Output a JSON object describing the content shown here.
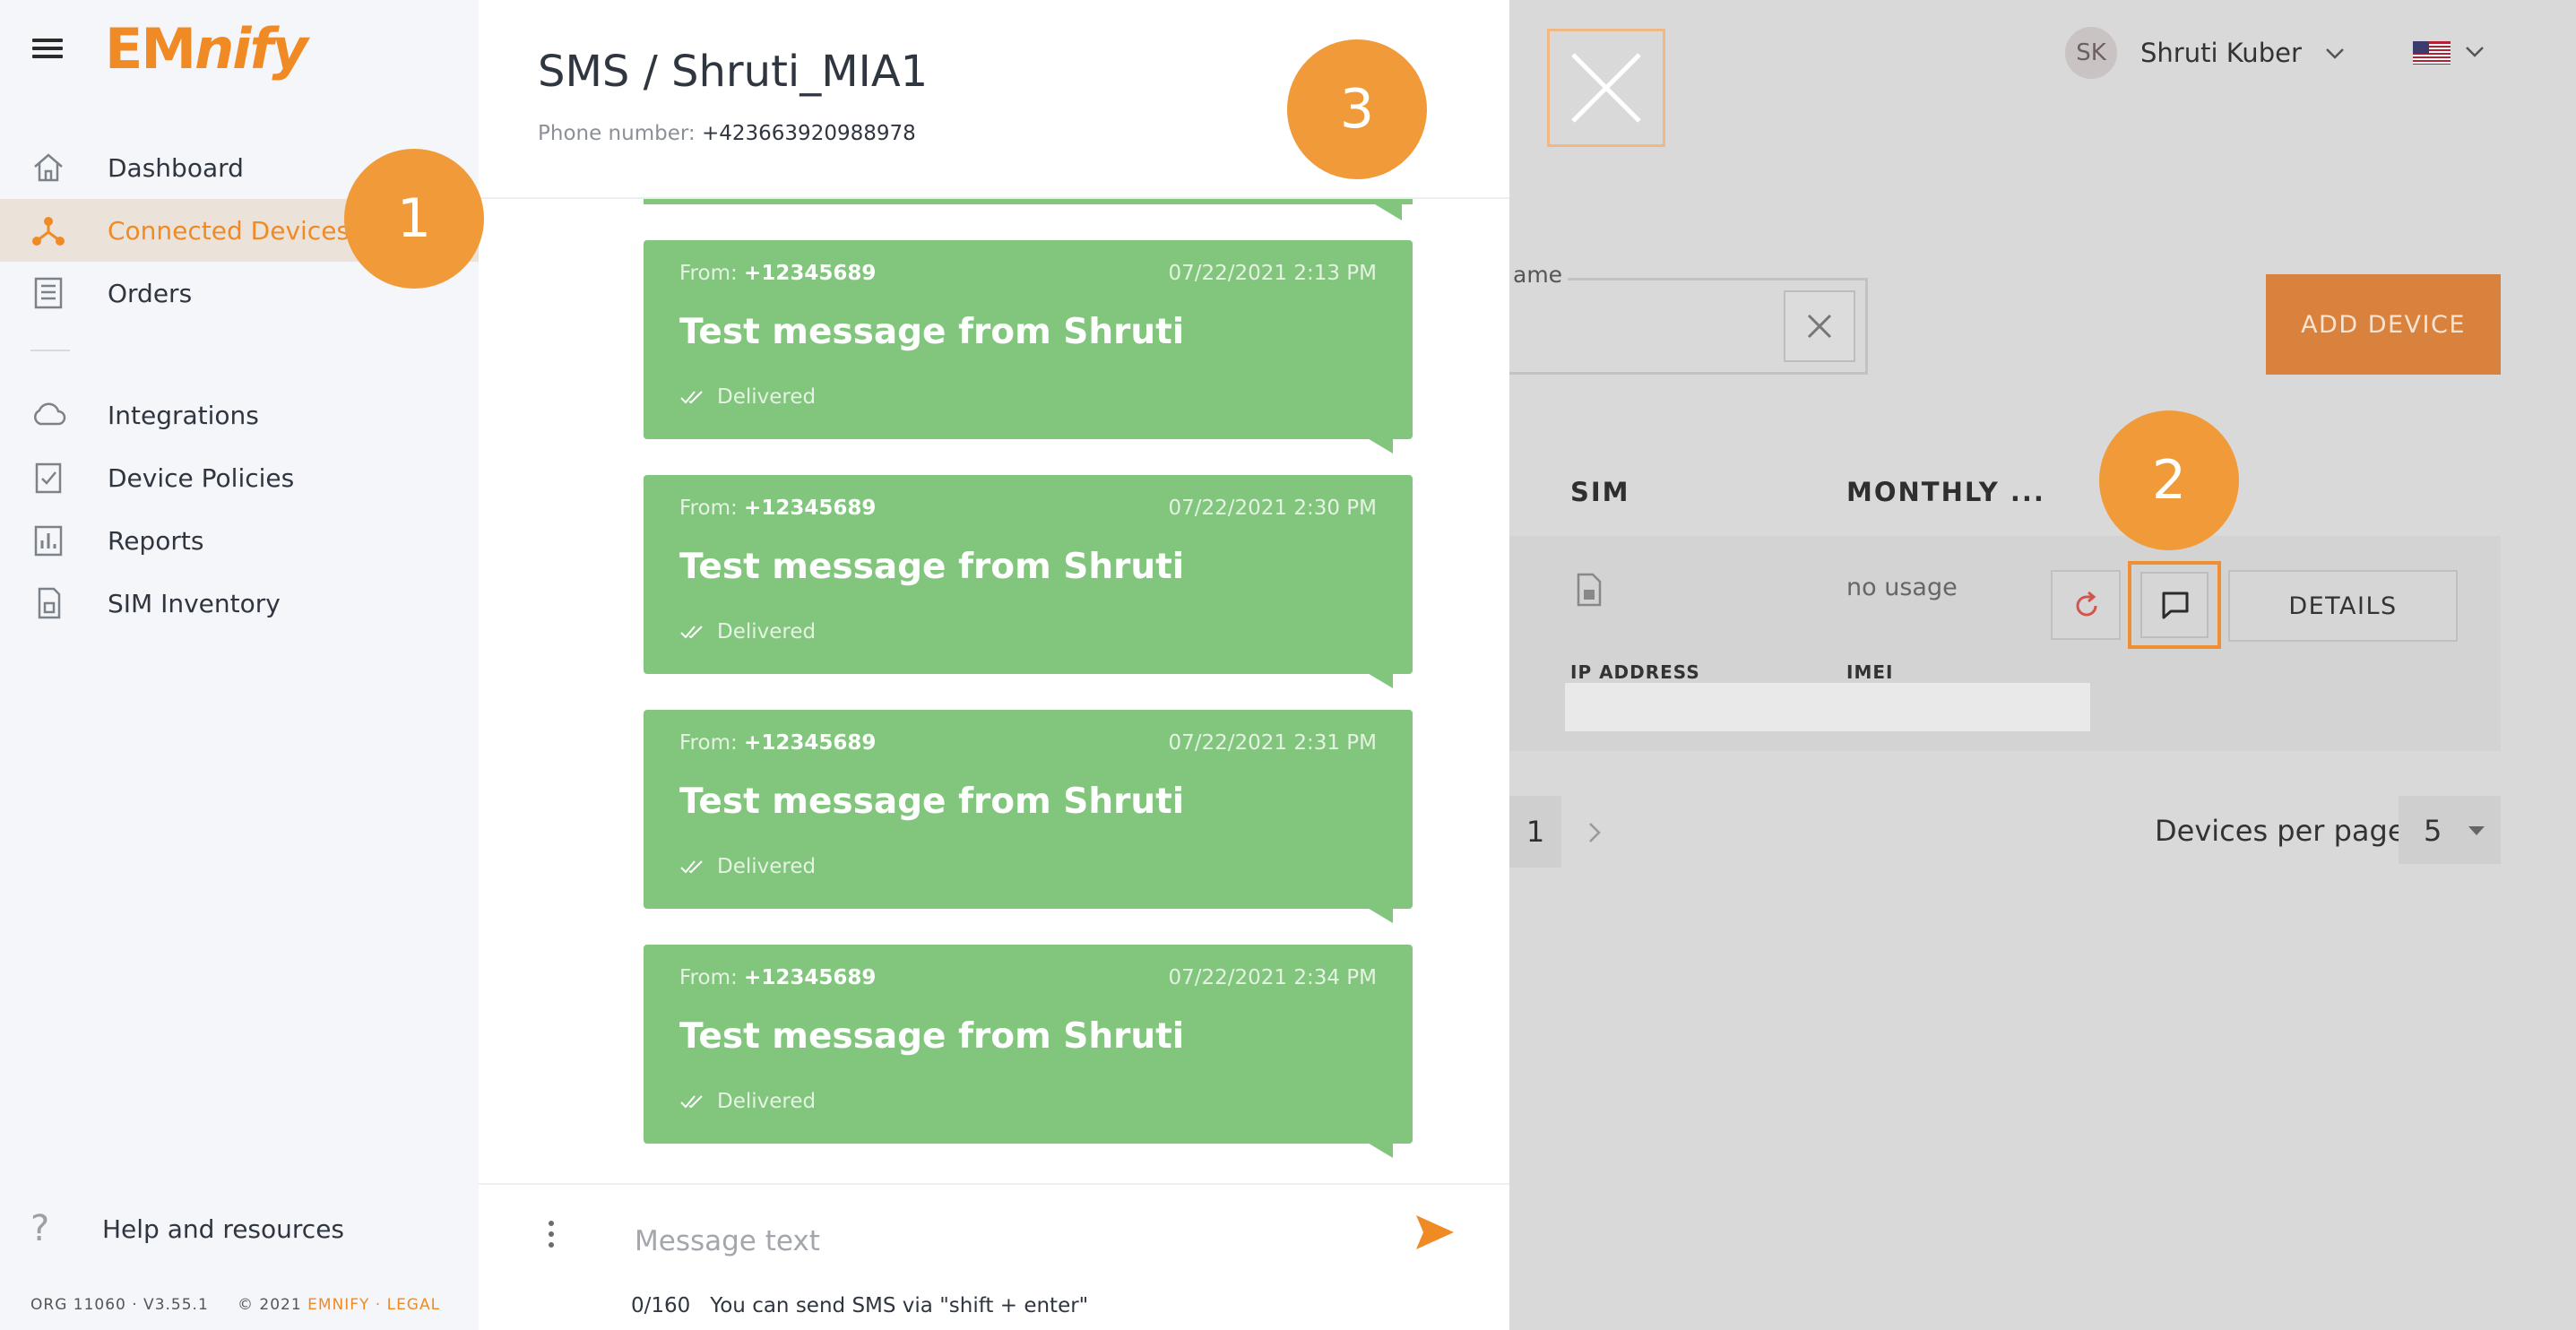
{
  "sidebar": {
    "logo": {
      "em": "EM",
      "nify": "nify"
    },
    "items": [
      {
        "label": "Dashboard",
        "icon": "home-icon"
      },
      {
        "label": "Connected Devices",
        "icon": "connected-devices-icon",
        "active": true
      },
      {
        "label": "Orders",
        "icon": "orders-icon"
      },
      {
        "label": "Integrations",
        "icon": "cloud-icon"
      },
      {
        "label": "Device Policies",
        "icon": "clipboard-check-icon"
      },
      {
        "label": "Reports",
        "icon": "bar-chart-icon"
      },
      {
        "label": "SIM Inventory",
        "icon": "sim-card-icon"
      }
    ],
    "help_label": "Help and resources",
    "footer_org": "ORG 11060 · V3.55.1",
    "footer_copy_prefix": "© 2021",
    "footer_copy_links": "EMNIFY · LEGAL"
  },
  "header": {
    "user_initials": "SK",
    "user_name": "Shruti Kuber"
  },
  "devices": {
    "search_label": "ame",
    "add_device_label": "ADD DEVICE",
    "columns": {
      "sim": "SIM",
      "monthly": "MONTHLY ..."
    },
    "row": {
      "usage": "no usage",
      "details_label": "DETAILS",
      "ip_label": "IP ADDRESS",
      "imei_label": "IMEI"
    },
    "pagination": {
      "current_page": "1",
      "per_page_label": "Devices per page",
      "per_page_value": "5"
    }
  },
  "badges": [
    "1",
    "2",
    "3"
  ],
  "sms_panel": {
    "title": "SMS / Shruti_MIA1",
    "phone_label": "Phone number:",
    "phone_number": "+423663920988978",
    "messages": [
      {
        "from_label": "From:",
        "from_number": "+12345689",
        "time": "07/22/2021 2:13 PM",
        "text": "Test message from Shruti",
        "status": "Delivered"
      },
      {
        "from_label": "From:",
        "from_number": "+12345689",
        "time": "07/22/2021 2:30 PM",
        "text": "Test message from Shruti",
        "status": "Delivered"
      },
      {
        "from_label": "From:",
        "from_number": "+12345689",
        "time": "07/22/2021 2:31 PM",
        "text": "Test message from Shruti",
        "status": "Delivered"
      },
      {
        "from_label": "From:",
        "from_number": "+12345689",
        "time": "07/22/2021 2:34 PM",
        "text": "Test message from Shruti",
        "status": "Delivered"
      }
    ],
    "input_placeholder": "Message text",
    "char_counter": "0/160",
    "hint": "You can send SMS via \"shift + enter\""
  },
  "colors": {
    "accent": "#f08a24",
    "message_bubble": "#82c67e",
    "badge": "#f09a3a"
  }
}
